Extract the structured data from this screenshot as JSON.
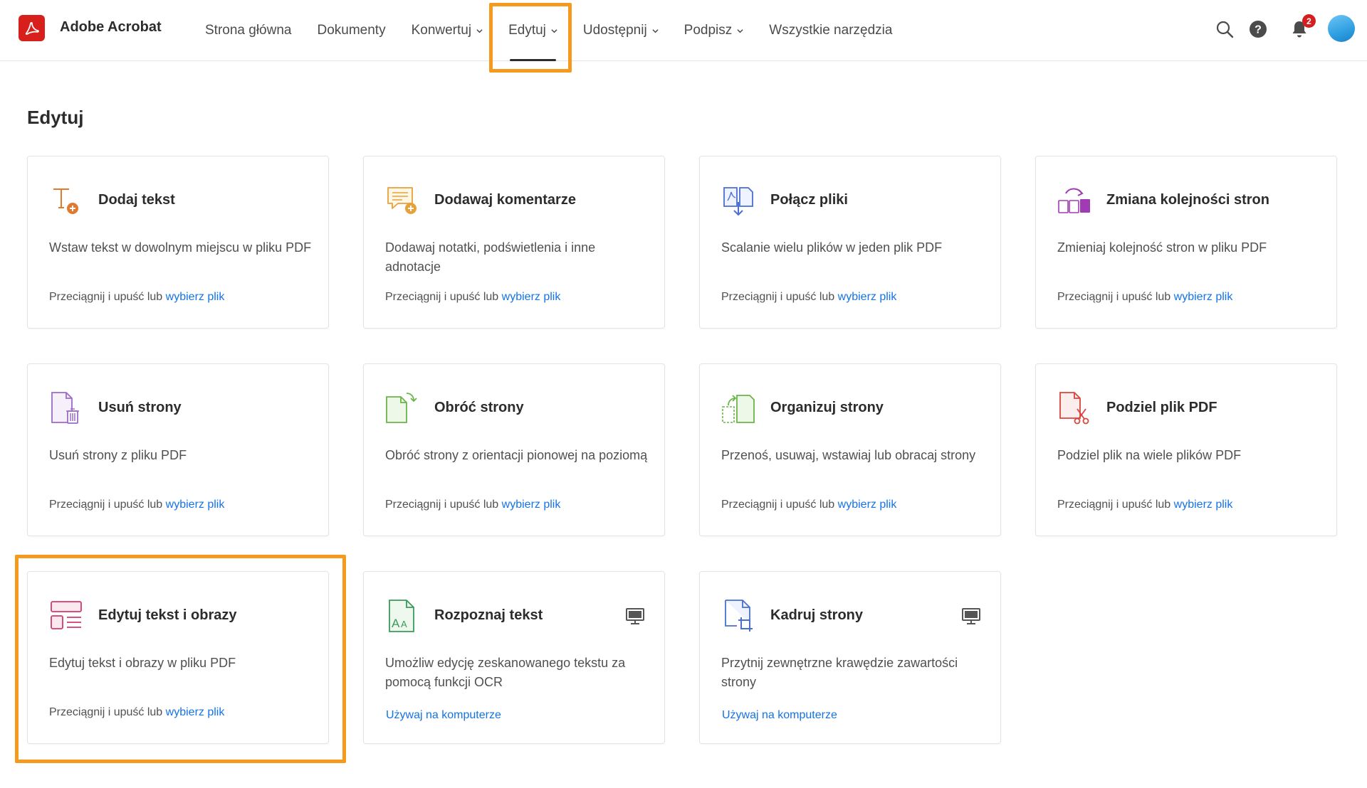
{
  "app": {
    "title": "Adobe Acrobat"
  },
  "nav": {
    "items": [
      {
        "label": "Strona główna",
        "dropdown": false
      },
      {
        "label": "Dokumenty",
        "dropdown": false
      },
      {
        "label": "Konwertuj",
        "dropdown": true
      },
      {
        "label": "Edytuj",
        "dropdown": true,
        "active": true
      },
      {
        "label": "Udostępnij",
        "dropdown": true
      },
      {
        "label": "Podpisz",
        "dropdown": true
      },
      {
        "label": "Wszystkie narzędzia",
        "dropdown": false
      }
    ]
  },
  "header_icons": {
    "notifications_count": "2"
  },
  "page": {
    "title": "Edytuj"
  },
  "cards": [
    {
      "title": "Dodaj tekst",
      "desc": "Wstaw tekst w dowolnym miejscu w pliku PDF",
      "action_text": "Przeciągnij i upuść lub",
      "action_link": "wybierz plik",
      "icon": "add-text-icon"
    },
    {
      "title": "Dodawaj komentarze",
      "desc": "Dodawaj notatki, podświetlenia i inne adnotacje",
      "action_text": "Przeciągnij i upuść lub",
      "action_link": "wybierz plik",
      "icon": "add-comment-icon"
    },
    {
      "title": "Połącz pliki",
      "desc": "Scalanie wielu plików w jeden plik PDF",
      "action_text": "Przeciągnij i upuść lub",
      "action_link": "wybierz plik",
      "icon": "combine-files-icon"
    },
    {
      "title": "Zmiana kolejności stron",
      "desc": "Zmieniaj kolejność stron w pliku PDF",
      "action_text": "Przeciągnij i upuść lub",
      "action_link": "wybierz plik",
      "icon": "reorder-pages-icon"
    },
    {
      "title": "Usuń strony",
      "desc": "Usuń strony z pliku PDF",
      "action_text": "Przeciągnij i upuść lub",
      "action_link": "wybierz plik",
      "icon": "delete-pages-icon"
    },
    {
      "title": "Obróć strony",
      "desc": "Obróć strony z orientacji pionowej na poziomą",
      "action_text": "Przeciągnij i upuść lub",
      "action_link": "wybierz plik",
      "icon": "rotate-pages-icon"
    },
    {
      "title": "Organizuj strony",
      "desc": "Przenoś, usuwaj, wstawiaj lub obracaj strony",
      "action_text": "Przeciągnij i upuść lub",
      "action_link": "wybierz plik",
      "icon": "organize-pages-icon"
    },
    {
      "title": "Podziel plik PDF",
      "desc": "Podziel plik na wiele plików PDF",
      "action_text": "Przeciągnij i upuść lub",
      "action_link": "wybierz plik",
      "icon": "split-pdf-icon"
    },
    {
      "title": "Edytuj tekst i obrazy",
      "desc": "Edytuj tekst i obrazy w pliku PDF",
      "action_text": "Przeciągnij i upuść lub",
      "action_link": "wybierz plik",
      "icon": "edit-text-images-icon"
    },
    {
      "title": "Rozpoznaj tekst",
      "desc": "Umożliw edycję zeskanowanego tekstu za pomocą funkcji OCR",
      "action_link": "Używaj na komputerze",
      "icon": "ocr-icon",
      "desktop": true
    },
    {
      "title": "Kadruj strony",
      "desc": "Przytnij zewnętrzne krawędzie zawartości strony",
      "action_link": "Używaj na komputerze",
      "icon": "crop-pages-icon",
      "desktop": true
    }
  ],
  "colors": {
    "accent": "#1473e6",
    "highlight": "#f39a1f",
    "brand": "#d7201b"
  }
}
